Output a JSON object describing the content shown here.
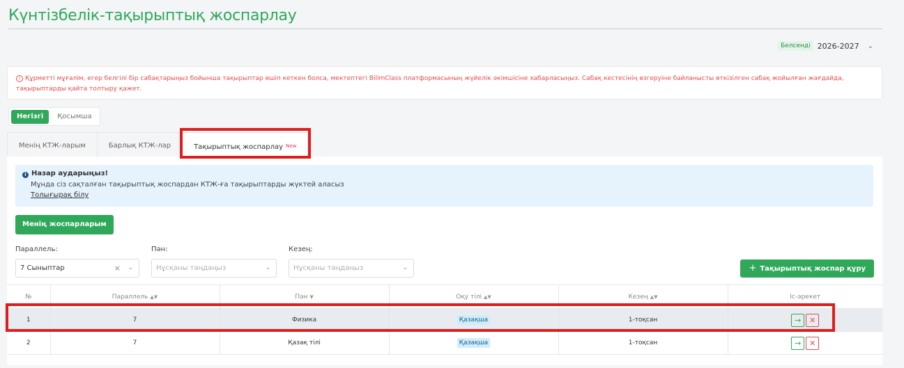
{
  "page": {
    "title": "Күнтізбелік-тақырыптық жоспарлау"
  },
  "year": {
    "status": "Белсенді",
    "value": "2026-2027"
  },
  "warning": {
    "text": "Құрметті мұғалім, егер белгілі бір сабақтарыңыз бойынша тақырыптар өшіп кеткен болса, мектептегі BilimClass платформасының жүйелік әкімшісіне хабарласыңыз. Сабақ кестесінің өзгеруіне байланысты өткізілген сабақ жойылған жағдайда, тақырыптарды қайта толтыру қажет."
  },
  "segments": [
    {
      "label": "Негізгі",
      "active": true
    },
    {
      "label": "Қосымша",
      "active": false
    }
  ],
  "tabs": [
    {
      "label": "Менің КТЖ-ларым"
    },
    {
      "label": "Барлық КТЖ-лар"
    },
    {
      "label": "Тақырыптық жоспарлау",
      "badge": "New"
    }
  ],
  "info": {
    "title": "Назар аударыңыз!",
    "text": "Мұнда сіз сақталған тақырыптық жоспардан КТЖ-ға тақырыптарды жүктей аласыз",
    "link": "Толығырақ білу"
  },
  "buttons": {
    "my_plans": "Менің жоспарларым",
    "create": "Тақырыптық жоспар құру"
  },
  "filters": {
    "parallel": {
      "label": "Параллель:",
      "value": "7 Сыныптар"
    },
    "subject": {
      "label": "Пән:",
      "placeholder": "Нұсқаны таңдаңыз"
    },
    "period": {
      "label": "Кезең:",
      "placeholder": "Нұсқаны таңдаңыз"
    }
  },
  "table": {
    "headers": {
      "num": "№",
      "parallel": "Параллель",
      "subject": "Пән",
      "lang": "Оқу тілі",
      "period": "Кезең",
      "action": "Іс-әрекет"
    },
    "rows": [
      {
        "num": "1",
        "parallel": "7",
        "subject": "Физика",
        "lang": "Қазақша",
        "period": "1-тоқсан"
      },
      {
        "num": "2",
        "parallel": "7",
        "subject": "Қазақ тілі",
        "lang": "Қазақша",
        "period": "1-тоқсан"
      }
    ]
  },
  "colors": {
    "accent": "#2fa85a",
    "danger": "#e44c4c",
    "highlight": "#e01d1d",
    "info_bg": "#e6f3fd"
  },
  "icons": {
    "info": "info-icon",
    "warning": "warning-icon",
    "go": "arrow-right-icon",
    "delete": "close-icon",
    "plus": "plus-icon",
    "chevron": "chevron-down-icon"
  }
}
